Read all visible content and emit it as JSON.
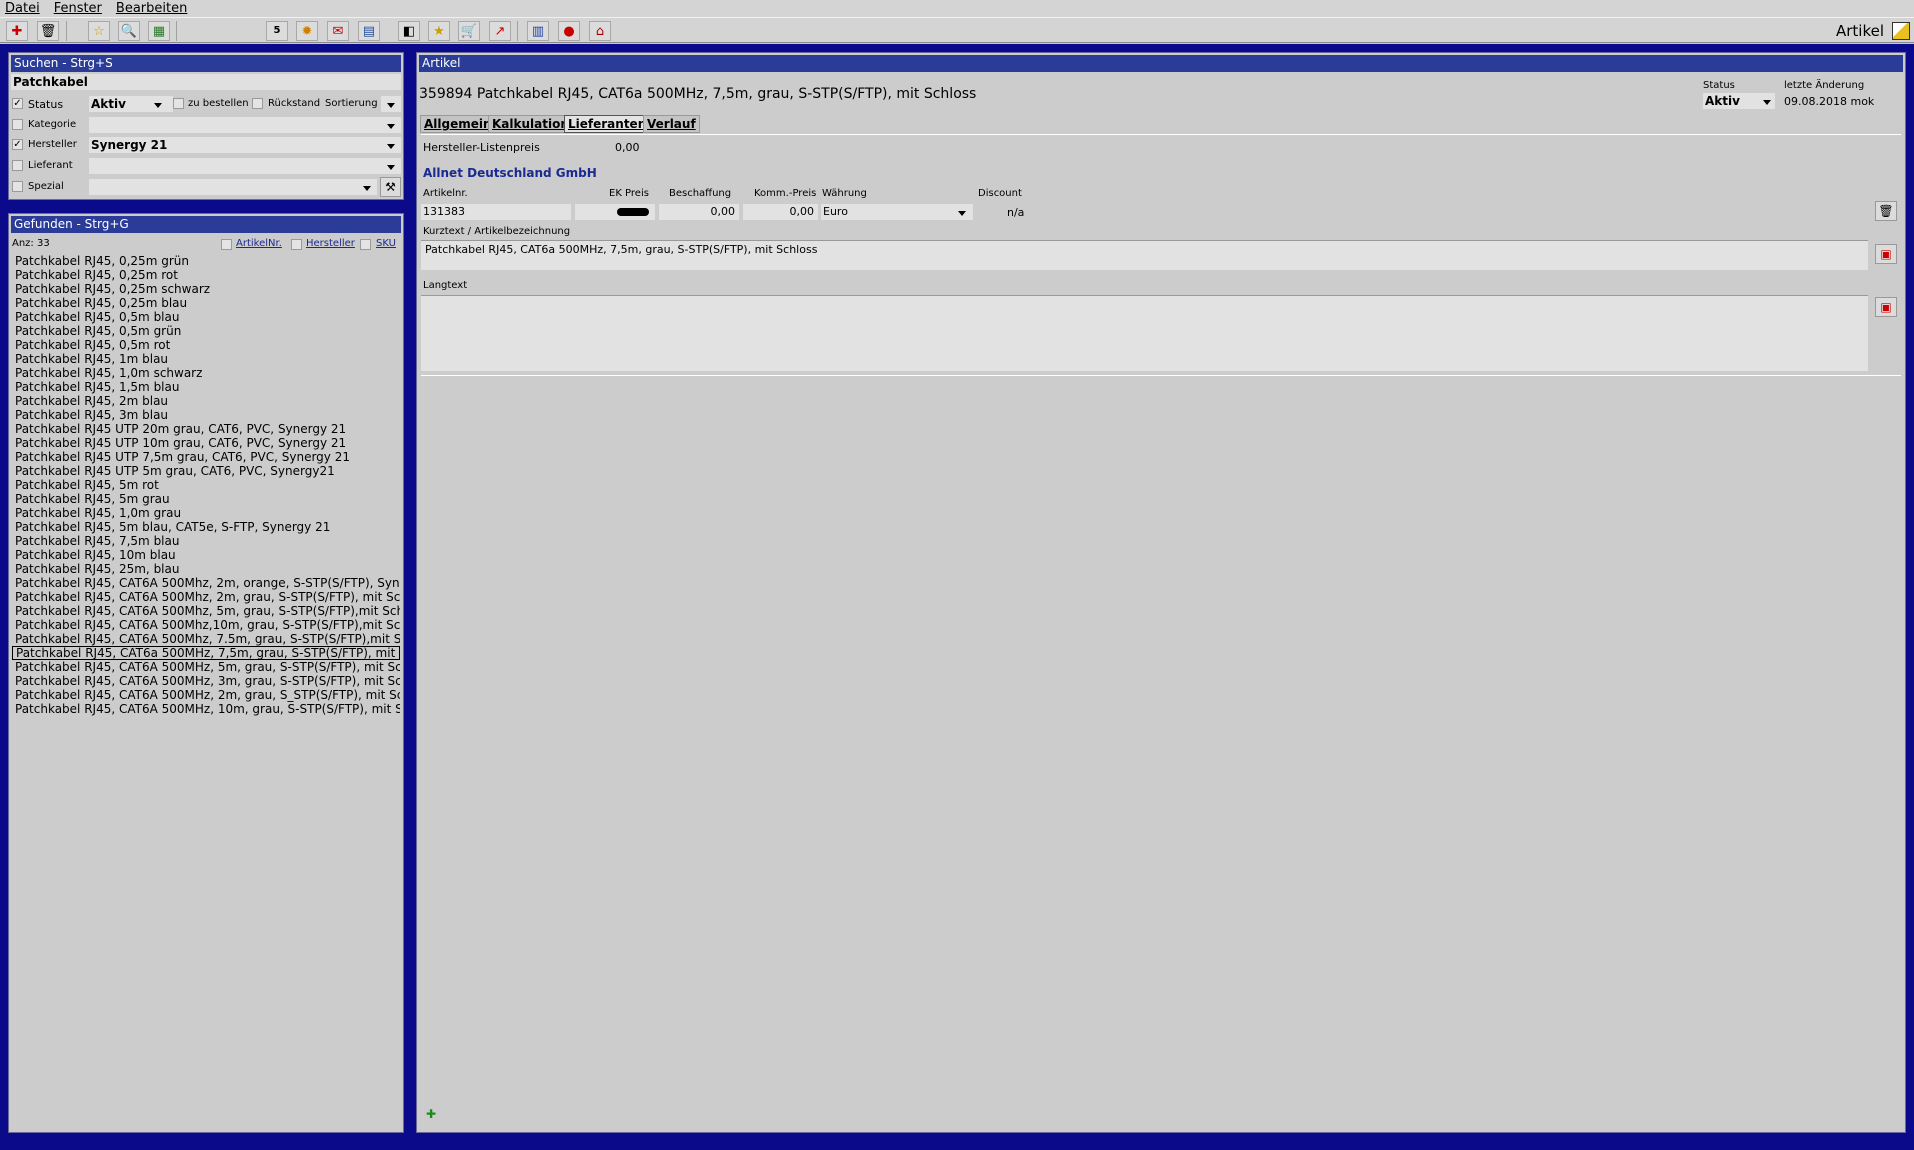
{
  "menu": {
    "items": [
      "Datei",
      "Fenster",
      "Bearbeiten"
    ]
  },
  "toolbar": {
    "title": "Artikel",
    "icons": [
      "new-icon",
      "trash-icon",
      "star-icon",
      "search-icon",
      "calculator-icon",
      "calendar-icon",
      "sun-icon",
      "mail-icon",
      "chart-window-icon",
      "window-icon",
      "star-pin-icon",
      "cart-icon",
      "graph-icon",
      "book-icon",
      "chat-icon",
      "home-icon"
    ]
  },
  "search": {
    "title": "Suchen - Strg+S",
    "text": "Patchkabel",
    "status_label": "Status",
    "status_value": "Aktiv",
    "zu_bestellen_label": "zu bestellen",
    "rueckstand_label": "Rückstand",
    "sortierung_label": "Sortierung",
    "kategorie_label": "Kategorie",
    "hersteller_label": "Hersteller",
    "hersteller_value": "Synergy 21",
    "lieferant_label": "Lieferant",
    "spezial_label": "Spezial"
  },
  "results": {
    "title": "Gefunden - Strg+G",
    "count": "Anz: 33",
    "filter_artikelnr": "ArtikelNr.",
    "filter_hersteller": "Hersteller",
    "filter_sku": "SKU",
    "items": [
      "Patchkabel RJ45, 0,25m grün",
      "Patchkabel RJ45, 0,25m rot",
      "Patchkabel RJ45, 0,25m schwarz",
      "Patchkabel RJ45, 0,25m blau",
      "Patchkabel RJ45, 0,5m blau",
      "Patchkabel RJ45, 0,5m grün",
      "Patchkabel RJ45, 0,5m rot",
      "Patchkabel RJ45, 1m blau",
      "Patchkabel RJ45, 1,0m schwarz",
      "Patchkabel RJ45, 1,5m blau",
      "Patchkabel RJ45, 2m blau",
      "Patchkabel RJ45, 3m blau",
      "Patchkabel RJ45 UTP 20m grau, CAT6, PVC, Synergy 21",
      "Patchkabel RJ45 UTP 10m grau, CAT6, PVC, Synergy 21",
      "Patchkabel RJ45 UTP 7,5m grau, CAT6, PVC, Synergy 21",
      "Patchkabel RJ45 UTP 5m grau, CAT6, PVC, Synergy21",
      "Patchkabel RJ45, 5m rot",
      "Patchkabel RJ45, 5m grau",
      "Patchkabel RJ45, 1,0m grau",
      "Patchkabel RJ45, 5m blau, CAT5e, S-FTP, Synergy 21",
      "Patchkabel RJ45, 7,5m blau",
      "Patchkabel RJ45, 10m blau",
      "Patchkabel RJ45, 25m, blau",
      "Patchkabel RJ45, CAT6A 500Mhz, 2m, orange, S-STP(S/FTP), Syn",
      "Patchkabel RJ45, CAT6A 500Mhz, 2m, grau, S-STP(S/FTP), mit Sc",
      "Patchkabel RJ45, CAT6A 500Mhz, 5m, grau, S-STP(S/FTP),mit Sch",
      "Patchkabel RJ45, CAT6A 500Mhz,10m, grau, S-STP(S/FTP),mit Sc",
      "Patchkabel RJ45, CAT6A 500Mhz, 7.5m, grau, S-STP(S/FTP),mit S",
      "Patchkabel RJ45, CAT6a 500MHz, 7,5m, grau, S-STP(S/FTP), mit S",
      "Patchkabel RJ45, CAT6A 500MHz, 5m, grau, S-STP(S/FTP), mit Sc",
      "Patchkabel RJ45, CAT6A 500MHz, 3m, grau, S-STP(S/FTP), mit Sc",
      "Patchkabel RJ45, CAT6A 500MHz, 2m, grau, S_STP(S/FTP), mit Sc",
      "Patchkabel RJ45, CAT6A 500MHz, 10m, grau, S-STP(S/FTP), mit S"
    ],
    "selected_index": 28
  },
  "article": {
    "panel_title": "Artikel",
    "heading": "359894 Patchkabel RJ45, CAT6a 500MHz, 7,5m, grau, S-STP(S/FTP), mit Schloss",
    "status_label": "Status",
    "status_value": "Aktiv",
    "last_change_label": "letzte Änderung",
    "last_change_value": "09.08.2018 mok",
    "tabs": [
      "Allgemein",
      "Kalkulation",
      "Lieferanten",
      "Verlauf"
    ],
    "active_tab": "Lieferanten",
    "hersteller_listenpreis_label": "Hersteller-Listenpreis",
    "hersteller_listenpreis_value": "0,00",
    "supplier_name": "Allnet Deutschland GmbH",
    "col_artikelnr": "Artikelnr.",
    "col_ek_preis": "EK Preis",
    "col_beschaffung": "Beschaffung",
    "col_komm_preis": "Komm.-Preis",
    "col_waehrung": "Währung",
    "col_discount": "Discount",
    "artikelnr_value": "131383",
    "beschaffung_value": "0,00",
    "komm_preis_value": "0,00",
    "waehrung_value": "Euro",
    "discount_value": "n/a",
    "kurztext_label": "Kurztext / Artikelbezeichnung",
    "kurztext_value": "Patchkabel RJ45, CAT6a 500MHz, 7,5m, grau, S-STP(S/FTP), mit Schloss",
    "langtext_label": "Langtext",
    "langtext_value": ""
  },
  "colors": {
    "frame": "#0a0a8a",
    "panel_title": "#2a3c98",
    "supplier": "#1a2a90"
  }
}
